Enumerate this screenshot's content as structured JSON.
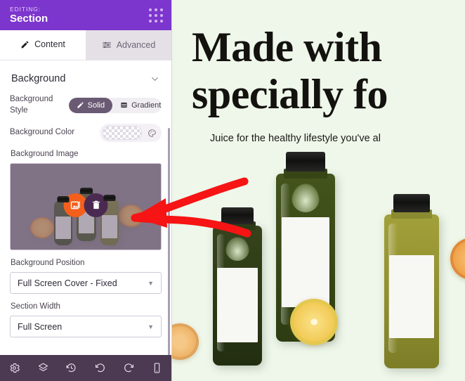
{
  "sidebar": {
    "header": {
      "editing_label": "EDITING:",
      "name": "Section",
      "grip_icon": "grid-dots-icon"
    },
    "tabs": [
      {
        "label": "Content",
        "icon": "pencil-icon",
        "active": true
      },
      {
        "label": "Advanced",
        "icon": "sliders-icon",
        "active": false
      }
    ],
    "section": {
      "title": "Background",
      "collapse_icon": "chevron-down-icon"
    },
    "background_style": {
      "label": "Background Style",
      "options": [
        {
          "label": "Solid",
          "icon": "pencil-icon",
          "selected": true
        },
        {
          "label": "Gradient",
          "icon": "gradient-icon",
          "selected": false
        }
      ]
    },
    "background_color": {
      "label": "Background Color",
      "value": "transparent",
      "palette_icon": "palette-icon"
    },
    "background_image": {
      "label": "Background Image",
      "edit_icon": "image-edit-icon",
      "delete_icon": "trash-icon"
    },
    "background_position": {
      "label": "Background Position",
      "value": "Full Screen Cover - Fixed",
      "caret_icon": "chevron-down-icon"
    },
    "section_width": {
      "label": "Section Width",
      "value": "Full Screen",
      "caret_icon": "chevron-down-icon"
    },
    "footer_buttons": [
      {
        "name": "settings",
        "icon": "gear-icon"
      },
      {
        "name": "layers",
        "icon": "layers-icon"
      },
      {
        "name": "revisions",
        "icon": "history-icon"
      },
      {
        "name": "undo",
        "icon": "undo-icon"
      },
      {
        "name": "redo",
        "icon": "redo-icon"
      },
      {
        "name": "responsive-preview",
        "icon": "mobile-icon"
      }
    ]
  },
  "canvas": {
    "headline": "Made with\nspecially fo",
    "subheadline": "Juice for the healthy lifestyle you've al",
    "annotation": {
      "type": "red-arrow",
      "direction": "left"
    }
  },
  "colors": {
    "header_purple": "#7c35cd",
    "footer_purple": "#4b3a52",
    "accent_orange": "#f4601b",
    "accent_dark_purple": "#4b2a52",
    "canvas_bg": "#eef7ea",
    "annotation_red": "#f61414"
  }
}
